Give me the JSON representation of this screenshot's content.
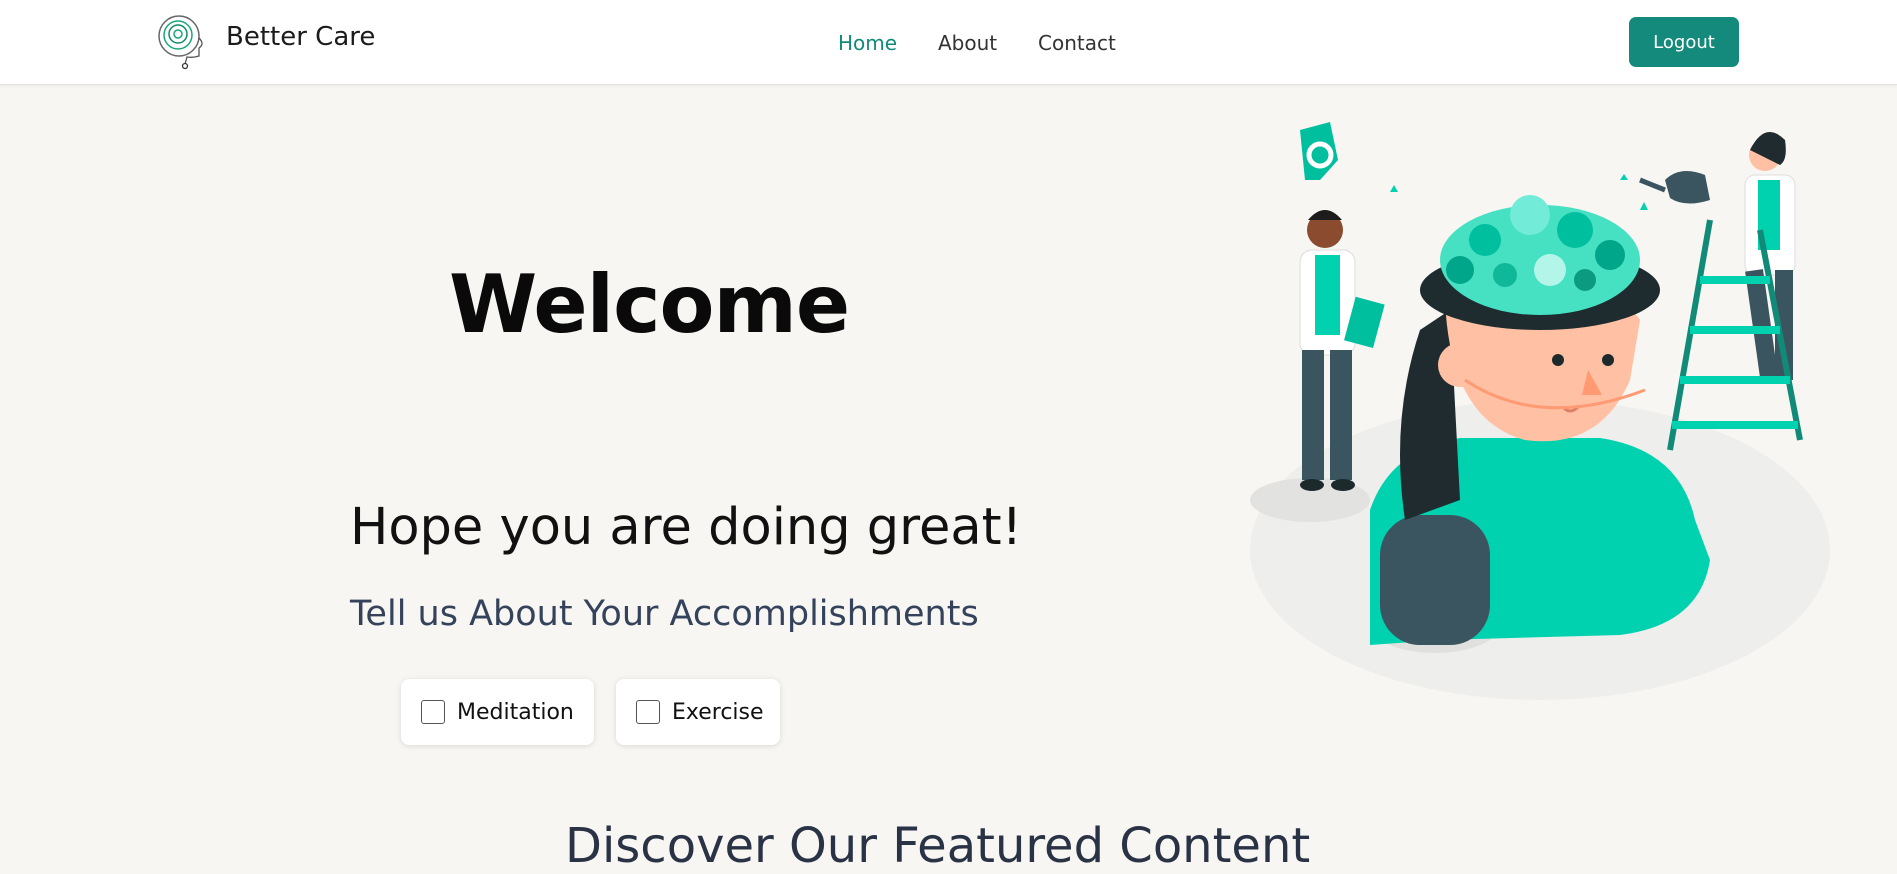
{
  "header": {
    "brand_name": "Better Care",
    "nav": [
      {
        "label": "Home",
        "active": true
      },
      {
        "label": "About",
        "active": false
      },
      {
        "label": "Contact",
        "active": false
      }
    ],
    "logout_label": "Logout",
    "accent_color": "#148a7c"
  },
  "hero": {
    "title": "Welcome",
    "greeting": "Hope you are doing great!",
    "prompt": "Tell us About Your Accomplishments",
    "checkboxes": [
      {
        "label": "Meditation",
        "checked": false
      },
      {
        "label": "Exercise",
        "checked": false
      }
    ],
    "illustration": "mind-garden-illustration"
  },
  "featured": {
    "heading": "Discover Our Featured Content"
  }
}
